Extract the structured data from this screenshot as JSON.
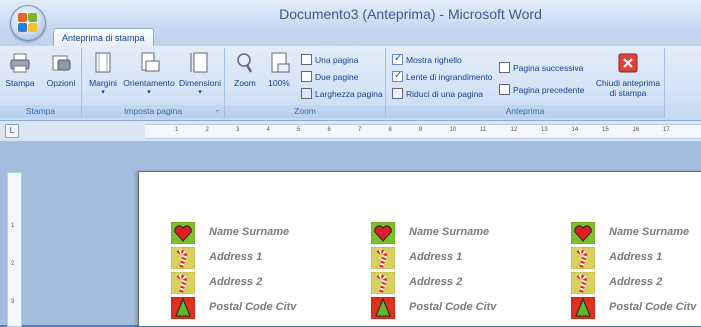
{
  "window": {
    "title": "Documento3 (Anteprima)  -  Microsoft Word"
  },
  "tabs": {
    "active": "Anteprima di stampa"
  },
  "ribbon": {
    "stampa_group": {
      "label": "Stampa",
      "print": "Stampa",
      "options": "Opzioni"
    },
    "layout_group": {
      "label": "Imposta pagina",
      "margins": "Margini",
      "orientation": "Orientamento",
      "size": "Dimensioni"
    },
    "zoom_group": {
      "label": "Zoom",
      "zoom": "Zoom",
      "hundred": "100%",
      "one_page": "Una pagina",
      "two_pages": "Due pagine",
      "page_width": "Larghezza pagina"
    },
    "preview_group": {
      "label": "Anteprima",
      "show_ruler": "Mostra righello",
      "magnifier": "Lente di ingrandimento",
      "shrink": "Riduci di una pagina",
      "next_page": "Pagina successiva",
      "prev_page": "Pagina precedente",
      "close_line1": "Chiudi anteprima",
      "close_line2": "di stampa"
    }
  },
  "ruler": {
    "ticks": [
      "1",
      "2",
      "3",
      "4",
      "5",
      "6",
      "7",
      "8",
      "9",
      "10",
      "11",
      "12",
      "13",
      "14",
      "15",
      "16",
      "17"
    ],
    "vticks": [
      "1",
      "2",
      "3"
    ]
  },
  "labels": {
    "name": "Name Surname",
    "address1": "Address 1",
    "address2": "Address 2",
    "postal": "Postal Code Citv"
  },
  "colors": {
    "heart": "#e02020",
    "green_stamp": "#7dbf2a",
    "candy_bg": "#d8d060",
    "tree_bg": "#e03020"
  }
}
